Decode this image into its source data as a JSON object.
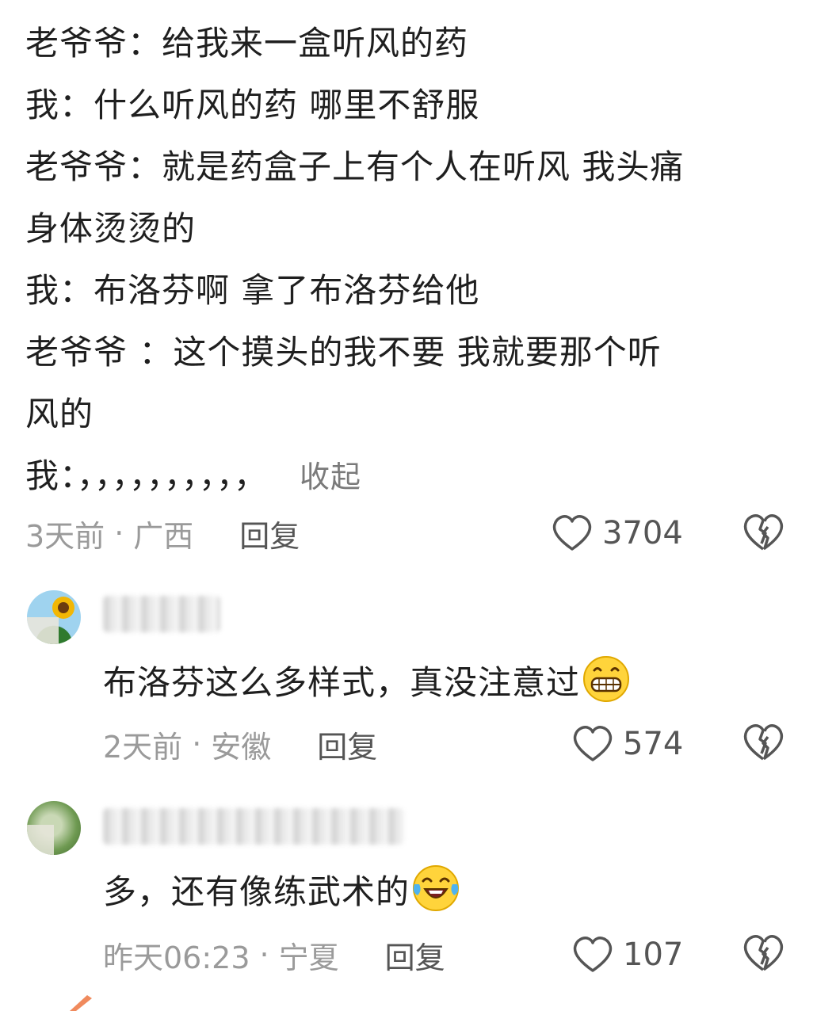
{
  "main_comment": {
    "lines": [
      "老爷爷：给我来一盒听风的药",
      "我：什么听风的药 哪里不舒服",
      "老爷爷：就是药盒子上有个人在听风 我头痛",
      "身体烫烫的",
      "我：布洛芬啊  拿了布洛芬给他",
      "老爷爷 ：这个摸头的我不要 我就要那个听",
      "风的",
      "我：，，，，，，，，，，"
    ],
    "collapse_label": "收起",
    "time": "3天前",
    "location": "广西",
    "reply_label": "回复",
    "likes": "3704"
  },
  "replies": [
    {
      "text": "布洛芬这么多样式，真没注意过",
      "emoji": "grin-emoji",
      "time": "2天前",
      "location": "安徽",
      "reply_label": "回复",
      "likes": "574"
    },
    {
      "text": "多，还有像练武术的",
      "emoji": "laugh-cry-emoji",
      "time": "昨天06:23",
      "location": "宁夏",
      "reply_label": "回复",
      "likes": "107"
    }
  ],
  "separator": "·",
  "colors": {
    "text": "#1f1f1f",
    "meta": "#9a9a9a",
    "action": "#555555"
  }
}
